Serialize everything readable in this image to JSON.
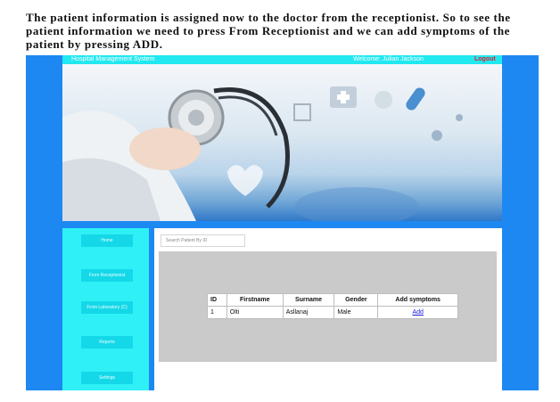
{
  "caption": "The patient information is assigned now to the doctor from the receptionist. So to see the patient information we need to press From Receptionist and we can add symptoms of the patient by pressing ADD.",
  "header": {
    "app_title": "Hospital Management System",
    "welcome": "Welcome: Julian Jackson",
    "logout_label": "Logout"
  },
  "sidebar": {
    "items": [
      {
        "label": "Home"
      },
      {
        "label": "From Receptionist"
      },
      {
        "label": "From Laboratory (C)"
      },
      {
        "label": "Reports"
      },
      {
        "label": "Settings"
      }
    ]
  },
  "search": {
    "placeholder": "Search Patient By ID"
  },
  "table": {
    "headers": [
      "ID",
      "Firstname",
      "Surname",
      "Gender",
      "Add symptoms"
    ],
    "rows": [
      {
        "id": "1",
        "firstname": "Olti",
        "surname": "Asllanaj",
        "gender": "Male",
        "action": "Add"
      }
    ]
  },
  "colors": {
    "frame": "#1e88f2",
    "topbar": "#22e8f0",
    "sidebar": "#2ff0f6",
    "sidebar_button": "#14d8e8",
    "logout": "#e0202a",
    "panel": "#cacaca",
    "link": "#1a1ad8"
  }
}
